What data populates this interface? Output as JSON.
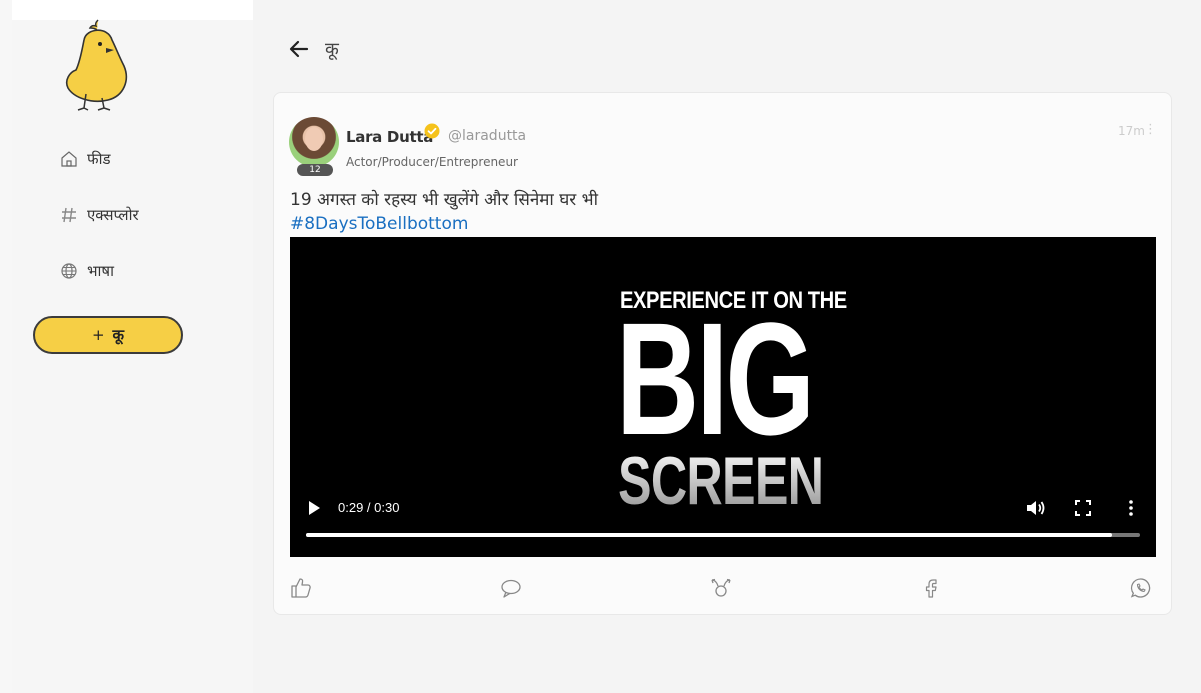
{
  "sidebar": {
    "logo_icon": "koo-bird-logo",
    "items": [
      {
        "label": "फीड",
        "icon": "home-icon"
      },
      {
        "label": "एक्सप्लोर",
        "icon": "hashtag-icon"
      },
      {
        "label": "भाषा",
        "icon": "globe-icon"
      }
    ],
    "koo_button": {
      "plus": "+",
      "label": "कू"
    }
  },
  "header": {
    "title": "कू",
    "back_icon": "arrow-left-icon"
  },
  "post": {
    "author_name": "Lara Dutta",
    "handle": "@laradutta",
    "bio": "Actor/Producer/Entrepreneur",
    "badge_count": "12",
    "time": "17m",
    "more_glyph": "⋮",
    "text": "19 अगस्त को रहस्य भी खुलेंगे और सिनेमा घर भी",
    "hashtag": "#8DaysToBellbottom",
    "video": {
      "line1": "EXPERIENCE IT ON THE",
      "line2": "BIG",
      "line3": "SCREEN",
      "time": "0:29 / 0:30",
      "progress": 0.967
    }
  },
  "colors": {
    "accent": "#f6cf45",
    "hashtag": "#1a6fc1",
    "verified": "#f5c21b"
  }
}
